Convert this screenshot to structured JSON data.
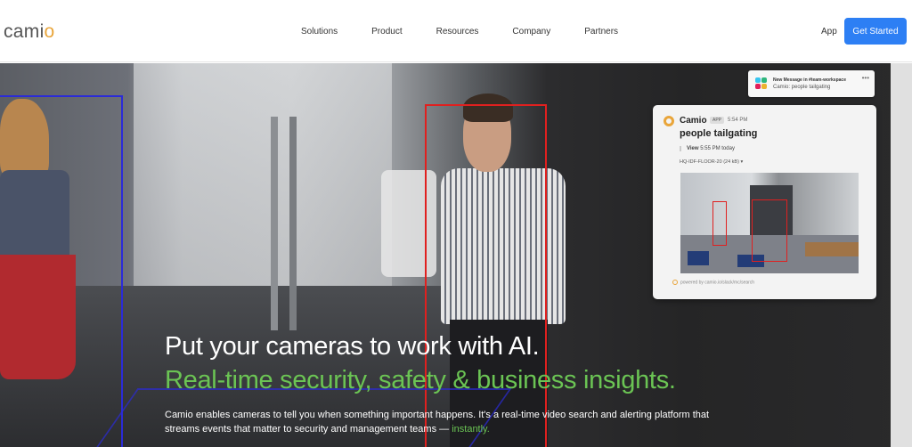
{
  "nav": {
    "logo_main": "cami",
    "logo_accent": "o",
    "menu": [
      "Solutions",
      "Product",
      "Resources",
      "Company",
      "Partners"
    ],
    "app_link": "App",
    "cta": "Get Started"
  },
  "notification": {
    "title": "New Message in #team-workspace",
    "body": "Camio: people tailgating"
  },
  "card": {
    "app_name": "Camio",
    "badge": "APP",
    "time": "5:54 PM",
    "title": "people tailgating",
    "view_label": "View",
    "view_detail": "5:55 PM today",
    "file": "HQ-IDF-FLOOR-20 (24 kB)",
    "footer": "powered by camio.io/slack/mc/search"
  },
  "hero": {
    "headline": "Put your cameras to work with AI.",
    "subhead": "Real-time security, safety & business insights.",
    "description": "Camio enables cameras to tell you when something important happens. It's a real-time video search and alerting platform that streams events that matter to security and management teams —",
    "description_highlight": "instantly."
  },
  "colors": {
    "accent_orange": "#e9a53a",
    "cta_blue": "#2d7ff4",
    "highlight_green": "#6bc454",
    "detection_red": "#e0201f",
    "detection_blue": "#2b2bd8"
  }
}
